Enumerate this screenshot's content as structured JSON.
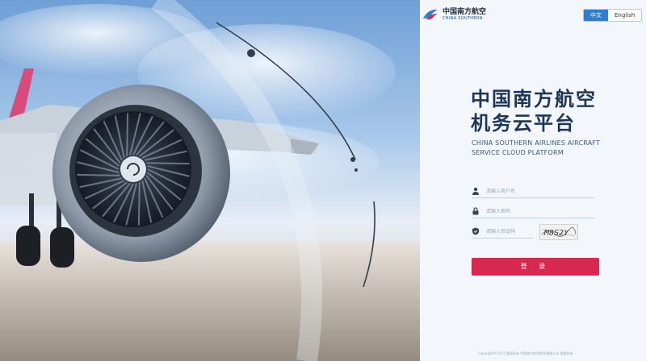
{
  "brand": {
    "name_cn": "中国南方航空",
    "name_en": "CHINA SOUTHERN",
    "color": "#d9284f"
  },
  "language": {
    "options": [
      "中文",
      "English"
    ],
    "active": "中文",
    "accent": "#2f7fd0"
  },
  "header": {
    "title_line1": "中国南方航空",
    "title_line2": "机务云平台",
    "subtitle_line1": "CHINA SOUTHERN AIRLINES AIRCRAFT",
    "subtitle_line2": "SERVICE CLOUD PLATFORM"
  },
  "form": {
    "username": {
      "placeholder": "请输入用户名",
      "value": "",
      "icon": "user-icon"
    },
    "password": {
      "placeholder": "请输入密码",
      "value": "",
      "icon": "lock-icon"
    },
    "captcha": {
      "placeholder": "请输入验证码",
      "value": "",
      "icon": "shield-icon",
      "image_text": "M8S2Y"
    },
    "login_label": "登 录"
  },
  "footer": {
    "copyright": "Copyright©2017 版权所有 中国南方航空股份有限公司 保留所有"
  }
}
